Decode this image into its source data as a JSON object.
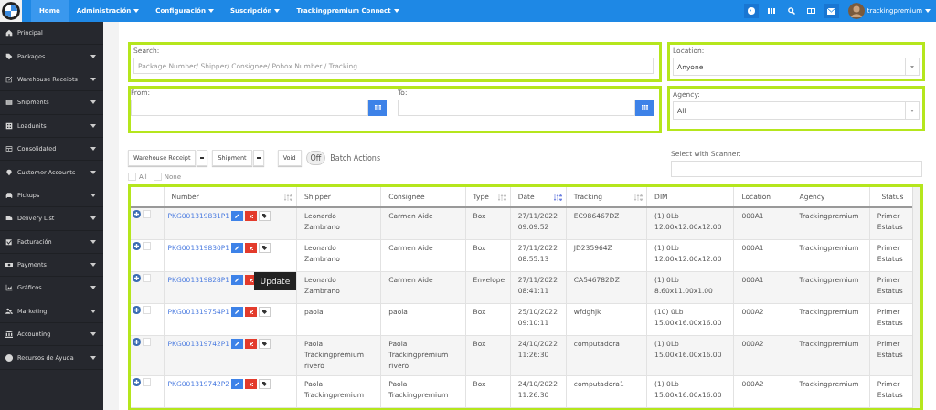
{
  "navbar": {
    "menu": [
      {
        "label": "Home",
        "selected": true,
        "dropdown": false
      },
      {
        "label": "Administración",
        "selected": false,
        "dropdown": true
      },
      {
        "label": "Configuración",
        "selected": false,
        "dropdown": true
      },
      {
        "label": "Suscripción",
        "selected": false,
        "dropdown": true
      },
      {
        "label": "Trackingpremium Connect",
        "selected": false,
        "dropdown": true
      }
    ],
    "user": "trackingpremium"
  },
  "sidebar": {
    "items": [
      {
        "label": "Principal",
        "has_submenu": false
      },
      {
        "label": "Packages",
        "has_submenu": true
      },
      {
        "label": "Warehouse Receipts",
        "has_submenu": true
      },
      {
        "label": "Shipments",
        "has_submenu": true
      },
      {
        "label": "Loadunits",
        "has_submenu": true
      },
      {
        "label": "Consolidated",
        "has_submenu": true
      },
      {
        "label": "Customer Accounts",
        "has_submenu": true
      },
      {
        "label": "Pickups",
        "has_submenu": true
      },
      {
        "label": "Delivery List",
        "has_submenu": true
      },
      {
        "label": "Facturación",
        "has_submenu": true
      },
      {
        "label": "Payments",
        "has_submenu": true
      },
      {
        "label": "Gráficos",
        "has_submenu": true
      },
      {
        "label": "Marketing",
        "has_submenu": true
      },
      {
        "label": "Accounting",
        "has_submenu": true
      },
      {
        "label": "Recursos de Ayuda",
        "has_submenu": true
      }
    ]
  },
  "filters": {
    "search": {
      "label": "Search:",
      "placeholder": "Package Number/ Shipper/ Consignee/ Pobox Number / Tracking"
    },
    "from": {
      "label": "From:"
    },
    "to": {
      "label": "To:"
    },
    "location": {
      "label": "Location:",
      "value": "Anyone"
    },
    "agency": {
      "label": "Agency:",
      "value": "All"
    },
    "scanner": {
      "label": "Select with Scanner:"
    }
  },
  "toolbar": {
    "dropdowns": [
      "Warehouse Receipt",
      "Shipment"
    ],
    "void": "Void",
    "batch_toggle": {
      "text": "Off",
      "on": false,
      "label": "Batch Actions"
    },
    "select_all": {
      "label": "All",
      "checked": false
    },
    "select_none": {
      "label": "None",
      "checked": false
    }
  },
  "table": {
    "columns": [
      {
        "sortable": false,
        "sorted": false
      },
      {
        "label": "Number",
        "sortable": true,
        "sorted": false
      },
      {
        "label": "Shipper",
        "sortable": false,
        "sorted": false
      },
      {
        "label": "Consignee",
        "sortable": false,
        "sorted": false
      },
      {
        "label": "Type",
        "sortable": true,
        "sorted": false
      },
      {
        "label": "Date",
        "sortable": true,
        "sorted": true
      },
      {
        "label": "Tracking",
        "sortable": true,
        "sorted": false
      },
      {
        "label": "DIM",
        "sortable": false,
        "sorted": false
      },
      {
        "label": "Location",
        "sortable": false,
        "sorted": false
      },
      {
        "label": "Agency",
        "sortable": false,
        "sorted": false
      },
      {
        "label": "Status",
        "sortable": false,
        "sorted": false
      }
    ],
    "rows": [
      {
        "checked": false,
        "number": "PKG001319831P1",
        "shipper": "Leonardo Zambrano",
        "consignee": "Carmen Aide",
        "type": "Box",
        "date": "27/11/2022 09:09:52",
        "tracking": "EC986467DZ",
        "dim": "(1) 0Lb 12.00x12.00x12.00",
        "location": "000A1",
        "agency": "Trackingpremium",
        "status": "Primer Estatus"
      },
      {
        "checked": false,
        "number": "PKG001319830P1",
        "shipper": "Leonardo Zambrano",
        "consignee": "Carmen Aide",
        "type": "Box",
        "date": "27/11/2022 08:55:13",
        "tracking": "JD235964Z",
        "dim": "(1) 0Lb 12.00x12.00x12.00",
        "location": "000A1",
        "agency": "Trackingpremium",
        "status": "Primer Estatus"
      },
      {
        "checked": false,
        "number": "PKG001319828P1",
        "shipper": "Leonardo Zambrano",
        "consignee": "Carmen Aide",
        "type": "Envelope",
        "date": "27/11/2022 08:41:11",
        "tracking": "CA546782DZ",
        "dim": "(1) 0Lb 8.60x11.00x1.00",
        "location": "000A1",
        "agency": "Trackingpremium",
        "status": "Primer Estatus",
        "tooltip": "Update"
      },
      {
        "checked": false,
        "number": "PKG001319754P1",
        "shipper": "paola",
        "consignee": "paola",
        "type": "Box",
        "date": "25/10/2022 09:10:11",
        "tracking": "wfdghjk",
        "dim": "(10) 0Lb 15.00x16.00x16.00",
        "location": "000A2",
        "agency": "Trackingpremium",
        "status": "Primer Estatus"
      },
      {
        "checked": false,
        "number": "PKG001319742P1",
        "shipper": "Paola Trackingpremium rivero",
        "consignee": "Paola Trackingpremium rivero",
        "type": "Box",
        "date": "24/10/2022 11:26:30",
        "tracking": "computadora",
        "dim": "(1) 0Lb 15.00x16.00x16.00",
        "location": "000A2",
        "agency": "Trackingpremium",
        "status": "Primer Estatus"
      },
      {
        "checked": false,
        "number": "PKG001319742P2",
        "shipper": "Paola Trackingpremium",
        "consignee": "Paola Trackingpremium",
        "type": "Box",
        "date": "24/10/2022 11:26:30",
        "tracking": "computadora1",
        "dim": "(1) 0Lb 15.00x16.00x16.00",
        "location": "000A2",
        "agency": "Trackingpremium",
        "status": "Primer Estatus"
      }
    ]
  }
}
